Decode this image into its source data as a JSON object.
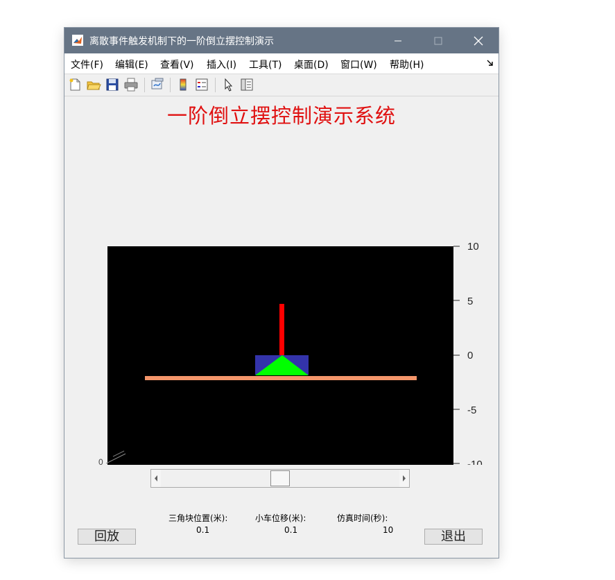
{
  "window": {
    "title": "离散事件触发机制下的一阶倒立摆控制演示"
  },
  "menu": {
    "items": [
      "文件(F)",
      "编辑(E)",
      "查看(V)",
      "插入(I)",
      "工具(T)",
      "桌面(D)",
      "窗口(W)",
      "帮助(H)"
    ]
  },
  "toolbar": {
    "icons": [
      "new-figure-icon",
      "open-file-icon",
      "save-icon",
      "print-icon",
      "link-plot-icon",
      "colorbar-icon",
      "legend-icon",
      "edit-plot-arrow-icon",
      "property-inspector-icon"
    ]
  },
  "main_title": "一阶倒立摆控制演示系统",
  "axes": {
    "y_ticks": [
      "10",
      "5",
      "0",
      "-5",
      "-10"
    ],
    "background": "#000000",
    "track_color": "#f4956a",
    "cart_color": "#3333aa",
    "triangle_color": "#00ff00",
    "pendulum_color": "#ff0000"
  },
  "slider": {
    "value_fraction": 0.5
  },
  "readouts": {
    "triangle_label": "三角块位置(米):",
    "triangle_value": "0.1",
    "cart_label": "小车位移(米):",
    "cart_value": "0.1",
    "time_label": "仿真时间(秒):",
    "time_value": "10"
  },
  "buttons": {
    "replay": "回放",
    "exit": "退出"
  }
}
